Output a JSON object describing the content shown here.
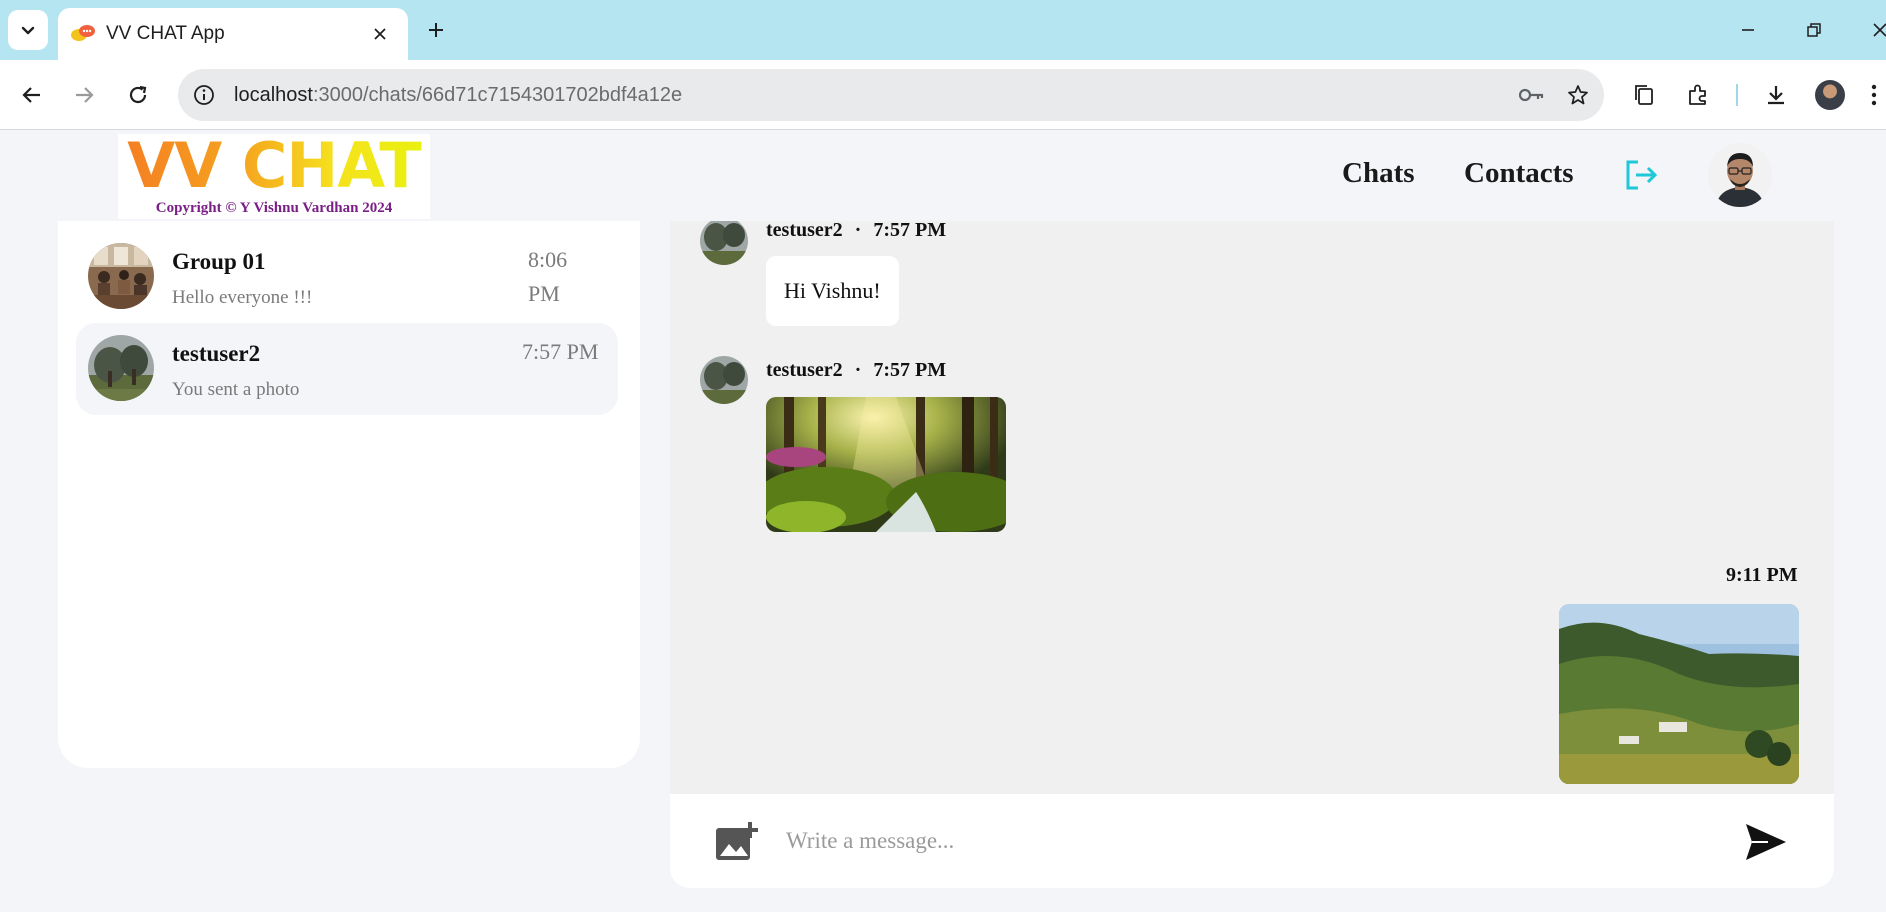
{
  "browser": {
    "tab_title": "VV CHAT App",
    "url_host": "localhost",
    "url_path": ":3000/chats/66d71c7154301702bdf4a12e"
  },
  "header": {
    "logo_text": "VV CHAT",
    "copyright": "Copyright © Y Vishnu Vardhan 2024",
    "nav": {
      "chats": "Chats",
      "contacts": "Contacts"
    },
    "accent_color": "#1fc8d8"
  },
  "chat_list": [
    {
      "name": "Group 01",
      "preview": "Hello everyone !!!",
      "time": "8:06 PM",
      "active": false
    },
    {
      "name": "testuser2",
      "preview": "You sent a photo",
      "time": "7:57 PM",
      "active": true
    }
  ],
  "messages": [
    {
      "sender": "testuser2",
      "time": "7:57 PM",
      "type": "text",
      "text": "Hi Vishnu!"
    },
    {
      "sender": "testuser2",
      "time": "7:57 PM",
      "type": "image",
      "image": "forest-photo"
    },
    {
      "sender": "",
      "time": "9:11 PM",
      "type": "image",
      "image": "mountain-photo",
      "own": true
    }
  ],
  "composer": {
    "placeholder": "Write a message..."
  }
}
